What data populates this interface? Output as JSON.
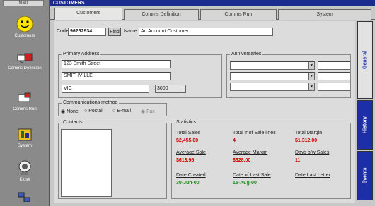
{
  "sidebar": {
    "top_label": "Main",
    "items": [
      {
        "label": "Customers",
        "icon": "smiley-icon"
      },
      {
        "label": "Comms Definition",
        "icon": "comms-icon"
      },
      {
        "label": "Comms Run",
        "icon": "comms-run-icon"
      },
      {
        "label": "System",
        "icon": "system-icon"
      },
      {
        "label": "Kiosk",
        "icon": "kiosk-icon"
      }
    ]
  },
  "window": {
    "title": "CUSTOMERS"
  },
  "tabs": [
    "Customers",
    "Comms Definition",
    "Comms Run",
    "System"
  ],
  "header": {
    "code_label": "Code",
    "code_value": "96262934",
    "find_label": "Find",
    "name_label": "Name",
    "name_value": "An Account Customer"
  },
  "address": {
    "title": "Primary Address",
    "line1": "123 Smith Street",
    "line2": "SMITHVILLE",
    "state": "VIC",
    "postcode": "3000"
  },
  "anniversaries": {
    "title": "Anniversaries"
  },
  "comms": {
    "title": "Communications method",
    "options": [
      "None",
      "Postal",
      "E-mail",
      "Fax"
    ]
  },
  "contacts": {
    "title": "Contacts"
  },
  "statistics": {
    "title": "Statistics",
    "items": [
      {
        "label": "Total Sales",
        "value": "$2,455.00",
        "color": "#d20000"
      },
      {
        "label": "Total # of Sale lines",
        "value": "4",
        "color": "#d20000"
      },
      {
        "label": "Total Margin",
        "value": "$1,312.00",
        "color": "#d20000"
      },
      {
        "label": "Average Sale",
        "value": "$613.95",
        "color": "#d20000"
      },
      {
        "label": "Average Margin",
        "value": "$328.00",
        "color": "#d20000"
      },
      {
        "label": "Days b/w Sales",
        "value": "11",
        "color": "#d20000"
      },
      {
        "label": "Date Created",
        "value": "30-Jun-00",
        "color": "#1a8a1a"
      },
      {
        "label": "Date of Last Sale",
        "value": "15-Aug-00",
        "color": "#1a8a1a"
      },
      {
        "label": "Date Last Letter",
        "value": "",
        "color": "#1a8a1a"
      }
    ]
  },
  "side_tabs": [
    "General",
    "History",
    "Events"
  ],
  "colors": {
    "titlebar": "#1a2c8e",
    "side_tab": "#1c2fa8"
  }
}
